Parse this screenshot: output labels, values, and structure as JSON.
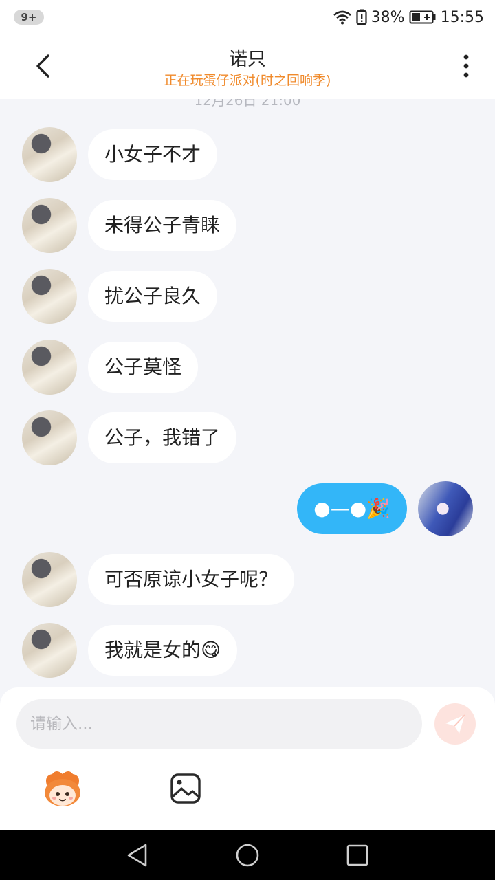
{
  "status_bar": {
    "notification_count": "9+",
    "battery_percent": "38%",
    "time": "15:55",
    "icons": [
      "wifi-icon",
      "battery-alert-icon",
      "battery-icon"
    ]
  },
  "header": {
    "title": "诺只",
    "subtitle": "正在玩蛋仔派对(时之回响季)",
    "back_icon": "chevron-left-icon",
    "more_icon": "more-vertical-icon",
    "subtitle_color": "#f08a2b"
  },
  "chat": {
    "timestamp": "12月26日 21:00",
    "messages": [
      {
        "side": "left",
        "text": "小女子不才"
      },
      {
        "side": "left",
        "text": "未得公子青睐"
      },
      {
        "side": "left",
        "text": "扰公子良久"
      },
      {
        "side": "left",
        "text": "公子莫怪"
      },
      {
        "side": "left",
        "text": "公子，我错了"
      },
      {
        "side": "right",
        "text": "●—●🎉"
      },
      {
        "side": "left",
        "text": "可否原谅小女子呢？"
      },
      {
        "side": "left",
        "text": "我就是女的😋"
      }
    ],
    "bubble_color_self": "#33b6f8",
    "bubble_color_other": "#ffffff"
  },
  "input": {
    "placeholder": "请输入...",
    "send_icon": "send-icon",
    "emoji_icon": "eggy-emoji-icon",
    "image_icon": "image-icon",
    "accent": "#fde3de"
  },
  "nav": {
    "icons": [
      "back-triangle-icon",
      "home-circle-icon",
      "recents-square-icon"
    ]
  }
}
